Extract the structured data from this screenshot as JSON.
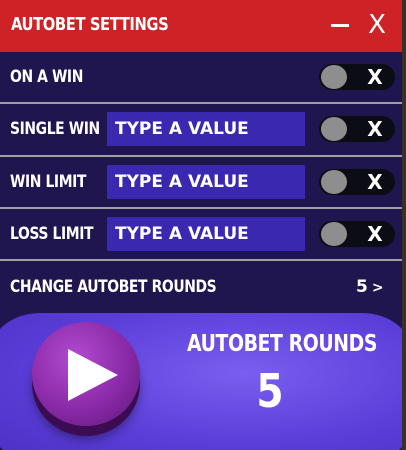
{
  "window": {
    "title": "AUTOBET SETTINGS",
    "minimize_symbol": "—",
    "close_symbol": "X"
  },
  "settings": [
    {
      "label": "ON A WIN",
      "has_input": false,
      "input_placeholder": "",
      "toggle_symbol": "X",
      "toggle_on": false
    },
    {
      "label": "SINGLE WIN",
      "has_input": true,
      "input_placeholder": "TYPE A VALUE",
      "toggle_symbol": "X",
      "toggle_on": false
    },
    {
      "label": "WIN LIMIT",
      "has_input": true,
      "input_placeholder": "TYPE A VALUE",
      "toggle_symbol": "X",
      "toggle_on": false
    },
    {
      "label": "LOSS LIMIT",
      "has_input": true,
      "input_placeholder": "TYPE A VALUE",
      "toggle_symbol": "X",
      "toggle_on": false
    }
  ],
  "change_rounds": {
    "label": "CHANGE AUTOBET ROUNDS",
    "value": "5",
    "chevron": ">"
  },
  "autobet": {
    "title": "AUTOBET ROUNDS",
    "rounds": "5",
    "play_icon": "play-icon"
  },
  "colors": {
    "titlebar": "#cf2226",
    "panel": "#1f1650",
    "input": "#3b28b0",
    "bottom": "#5b3ed8",
    "play_button": "#8a2aa8"
  }
}
